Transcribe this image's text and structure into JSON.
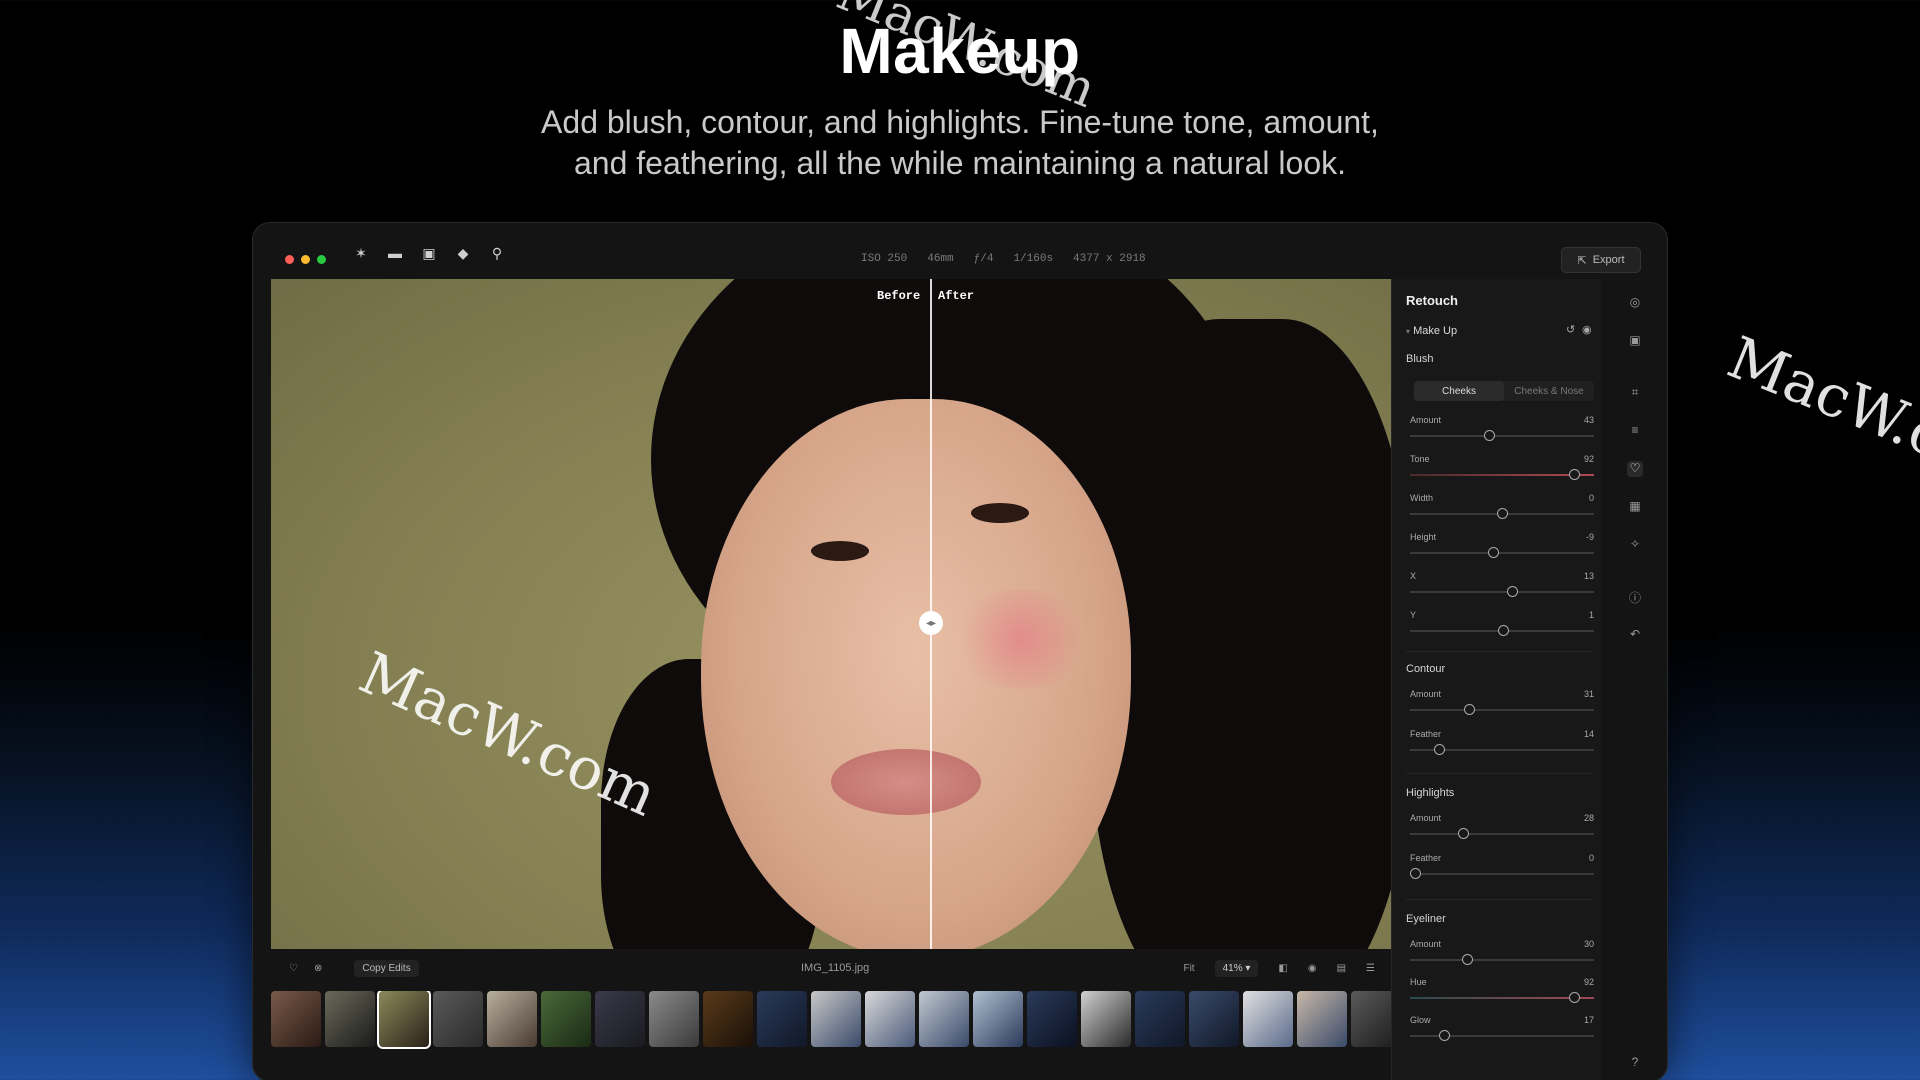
{
  "hero": {
    "title": "Makeup",
    "subtitle_line1": "Add blush, contour, and highlights. Fine-tune tone, amount,",
    "subtitle_line2": "and feathering, all the while maintaining a natural look."
  },
  "watermark": "MacW.com",
  "toolbar": {
    "meta": [
      "ISO 250",
      "46mm",
      "ƒ/4",
      "1/160s",
      "4377 x 2918"
    ],
    "export_label": "Export"
  },
  "canvas": {
    "before_label": "Before",
    "after_label": "After"
  },
  "bottombar": {
    "copy_edits_label": "Copy Edits",
    "filename": "IMG_1105.jpg",
    "fit_label": "Fit",
    "zoom": "41% ▾"
  },
  "panel": {
    "title": "Retouch",
    "makeup_label": "Make Up",
    "blush": {
      "label": "Blush",
      "seg": [
        "Cheeks",
        "Cheeks & Nose"
      ],
      "amount": {
        "label": "Amount",
        "value": "43",
        "level": 43
      },
      "tone": {
        "label": "Tone",
        "value": "92",
        "level": 92
      },
      "width": {
        "label": "Width",
        "value": "0",
        "level": 50
      },
      "height": {
        "label": "Height",
        "value": "-9",
        "level": 45
      },
      "x": {
        "label": "X",
        "value": "13",
        "level": 56
      },
      "y": {
        "label": "Y",
        "value": "1",
        "level": 51
      }
    },
    "contour": {
      "label": "Contour",
      "amount": {
        "label": "Amount",
        "value": "31",
        "level": 31
      },
      "feather": {
        "label": "Feather",
        "value": "14",
        "level": 14
      }
    },
    "highlights": {
      "label": "Highlights",
      "amount": {
        "label": "Amount",
        "value": "28",
        "level": 28
      },
      "feather": {
        "label": "Feather",
        "value": "0",
        "level": 0
      }
    },
    "eyeliner": {
      "label": "Eyeliner",
      "amount": {
        "label": "Amount",
        "value": "30",
        "level": 30
      },
      "hue": {
        "label": "Hue",
        "value": "92",
        "level": 92
      },
      "glow": {
        "label": "Glow",
        "value": "17",
        "level": 17
      }
    }
  },
  "colors": {
    "accent_red": "#ff5f57",
    "accent_yellow": "#febc2e",
    "accent_green": "#28c840",
    "backdrop": "#8b8a5a"
  },
  "icons": [
    "sparkle-icon",
    "folder-icon",
    "import-icon",
    "eraser-icon",
    "search-icon",
    "export-icon",
    "heart-icon",
    "reject-icon",
    "compare-icon",
    "eye-icon",
    "panel-icon",
    "sort-icon"
  ]
}
